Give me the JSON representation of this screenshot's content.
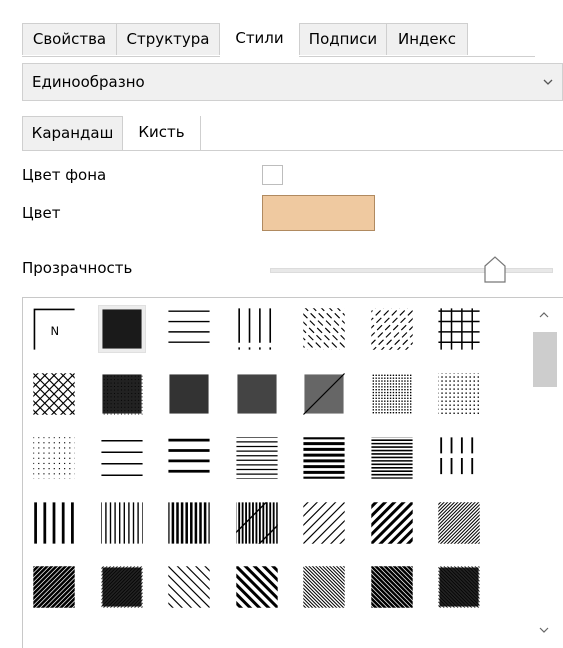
{
  "tabs": {
    "items": [
      "Свойства",
      "Структура",
      "Стили",
      "Подписи",
      "Индекс"
    ],
    "active": "Стили"
  },
  "fill_mode": {
    "value": "Единообразно"
  },
  "subtabs": {
    "items": [
      "Карандаш",
      "Кисть"
    ],
    "active": "Кисть"
  },
  "fields": {
    "background_label": "Цвет фона",
    "color_label": "Цвет",
    "color_value": "#efc9a0",
    "transparency_label": "Прозрачность",
    "transparency_level": 0.8
  },
  "patterns": {
    "selected_index": 1,
    "first_label": "N",
    "items": [
      "none-pattern",
      "solid-pattern",
      "horizontal-wide-pattern",
      "vertical-irregular-pattern",
      "backslash-dashed-pattern",
      "slash-dashed-pattern",
      "grid-pattern",
      "diagonal-cross-pattern",
      "dots-90-pattern",
      "dots-80-pattern",
      "dots-70-pattern",
      "dots-60-pattern",
      "dots-30-pattern",
      "dots-20-pattern",
      "dots-10-pattern",
      "horizontal-thin-pattern",
      "horizontal-medium-pattern",
      "horizontal-dense-pattern",
      "horizontal-heavy-pattern",
      "horizontal-very-dense-pattern",
      "vertical-dashed-pattern",
      "vertical-wide-pattern",
      "vertical-thin-pattern",
      "vertical-dense-pattern",
      "vertical-bold-pattern",
      "slash-thin-pattern",
      "slash-bold-pattern",
      "slash-dense-pattern",
      "slash-heavy-pattern",
      "slash-solid-pattern",
      "backslash-thin-pattern",
      "backslash-bold-pattern",
      "backslash-dense-pattern",
      "backslash-heavy-pattern",
      "backslash-solid-pattern"
    ]
  }
}
